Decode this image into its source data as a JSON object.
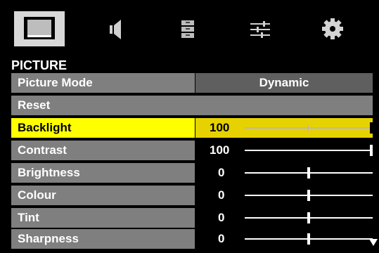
{
  "tabs": [
    {
      "name": "picture",
      "icon": "picture-icon",
      "active": true
    },
    {
      "name": "sound",
      "icon": "speaker-icon",
      "active": false
    },
    {
      "name": "channels",
      "icon": "list-icon",
      "active": false
    },
    {
      "name": "settings",
      "icon": "sliders-icon",
      "active": false
    },
    {
      "name": "setup",
      "icon": "gear-icon",
      "active": false
    }
  ],
  "section_title": "PICTURE",
  "rows": {
    "picture_mode": {
      "label": "Picture Mode",
      "value": "Dynamic"
    },
    "reset": {
      "label": "Reset"
    },
    "backlight": {
      "label": "Backlight",
      "value": "100",
      "level": 1.0
    },
    "contrast": {
      "label": "Contrast",
      "value": "100",
      "level": 1.0
    },
    "brightness": {
      "label": "Brightness",
      "value": "0",
      "level": 0.5
    },
    "colour": {
      "label": "Colour",
      "value": "0",
      "level": 0.5
    },
    "tint": {
      "label": "Tint",
      "value": "0",
      "level": 0.5
    },
    "sharpness": {
      "label": "Sharpness",
      "value": "0",
      "level": 0.5
    }
  },
  "colors": {
    "background": "#000000",
    "row_label_bg": "#7f7f7f",
    "row_value_bg": "#5f5f5f",
    "highlight": "#ffff00",
    "highlight_value_bg": "#e6d200",
    "active_tab": "#d8d8d8"
  }
}
